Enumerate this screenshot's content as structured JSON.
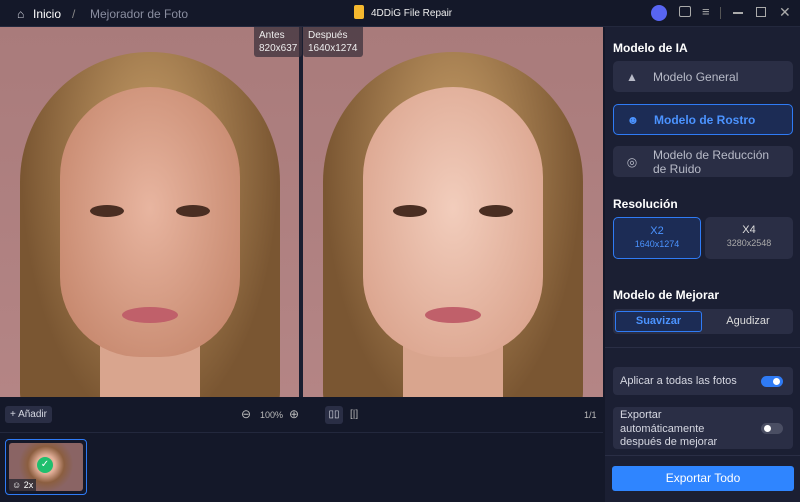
{
  "titlebar": {
    "home": "Inicio",
    "separator": "/",
    "page": "Mejorador de Foto",
    "app_title": "4DDiG File Repair"
  },
  "compare": {
    "before_label": "Antes",
    "before_size": "820x637",
    "after_label": "Después",
    "after_size": "1640x1274"
  },
  "panel": {
    "ai_model_title": "Modelo de IA",
    "models": [
      {
        "label": "Modelo General"
      },
      {
        "label": "Modelo de Rostro"
      },
      {
        "label": "Modelo de Reducción de Ruido"
      }
    ],
    "resolution_title": "Resolución",
    "resolutions": [
      {
        "label": "X2",
        "size": "1640x1274"
      },
      {
        "label": "X4",
        "size": "3280x2548"
      }
    ],
    "enhance_title": "Modelo de Mejorar",
    "enhance_options": [
      "Suavizar",
      "Agudizar"
    ],
    "apply_all": "Aplicar a todas las fotos",
    "apply_all_on": true,
    "auto_export": "Exportar automáticamente después de mejorar",
    "auto_export_on": false,
    "export_all": "Exportar Todo"
  },
  "toolbar": {
    "add": "+ Añadir",
    "zoom": "100%",
    "page": "1/1"
  },
  "thumbnail": {
    "scale": "2x"
  },
  "colors": {
    "accent": "#2f7bf5",
    "bg": "#141829",
    "panel": "#1b1f33"
  }
}
